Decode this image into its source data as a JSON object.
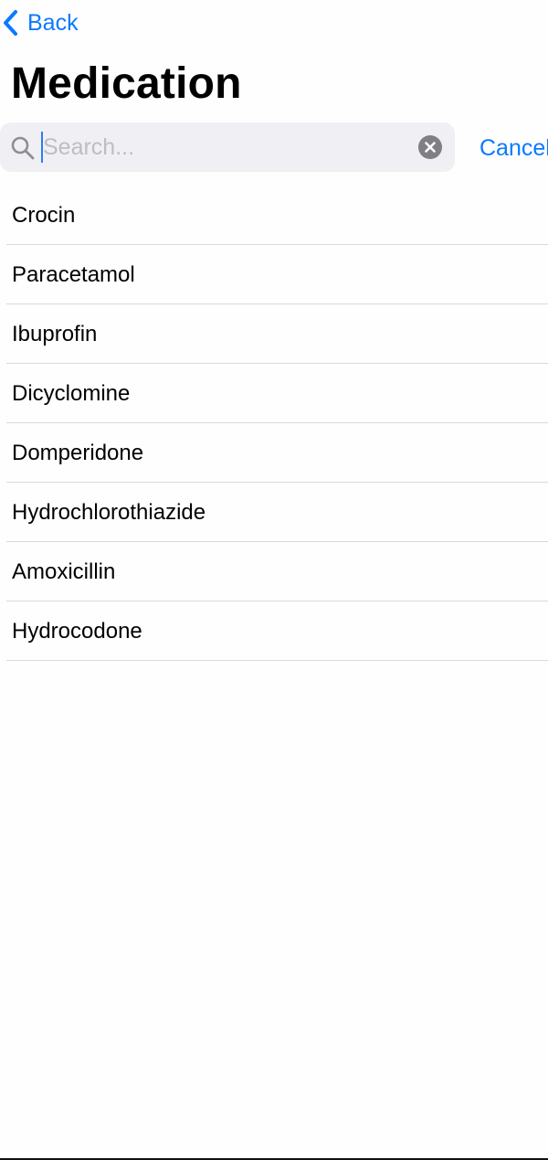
{
  "nav": {
    "back_label": "Back"
  },
  "page": {
    "title": "Medication"
  },
  "search": {
    "value": "",
    "placeholder": "Search...",
    "cancel_label": "Cancel"
  },
  "colors": {
    "accent": "#0A7AFF",
    "search_background": "#EFEFF4",
    "separator": "#D9D9DC",
    "placeholder": "#BDBDC2"
  },
  "icons": {
    "back": "chevron-left-icon",
    "search": "magnifying-glass-icon",
    "clear": "clear-x-circle-icon"
  },
  "medications": [
    {
      "name": "Crocin"
    },
    {
      "name": "Paracetamol"
    },
    {
      "name": "Ibuprofin"
    },
    {
      "name": "Dicyclomine"
    },
    {
      "name": "Domperidone"
    },
    {
      "name": "Hydrochlorothiazide"
    },
    {
      "name": "Amoxicillin"
    },
    {
      "name": "Hydrocodone"
    }
  ]
}
